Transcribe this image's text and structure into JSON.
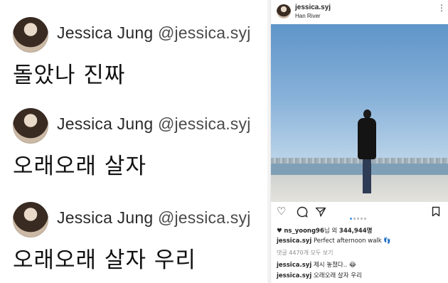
{
  "tweets": [
    {
      "name": "Jessica Jung",
      "handle": "@jessica.syj",
      "text": "돌았나 진짜"
    },
    {
      "name": "Jessica Jung",
      "handle": "@jessica.syj",
      "text": "오래오래 살자"
    },
    {
      "name": "Jessica Jung",
      "handle": "@jessica.syj",
      "text": "오래오래 살자 우리"
    }
  ],
  "instagram": {
    "username": "jessica.syj",
    "location": "Han River",
    "likes_prefix": "ns_yoong96",
    "likes_mid": "님 외",
    "likes_count": "344,944명",
    "caption_user": "jessica.syj",
    "caption_text": "Perfect afternoon walk 👣",
    "view_all_comments": "댓글 4470개 모두 보기",
    "comments": [
      {
        "user": "jessica.syj",
        "text": "제시 놓쳤다.. 😂"
      },
      {
        "user": "jessica.syj",
        "text": "오래오래 살자 우리"
      }
    ],
    "carousel_dots": 5,
    "active_dot": 0
  }
}
